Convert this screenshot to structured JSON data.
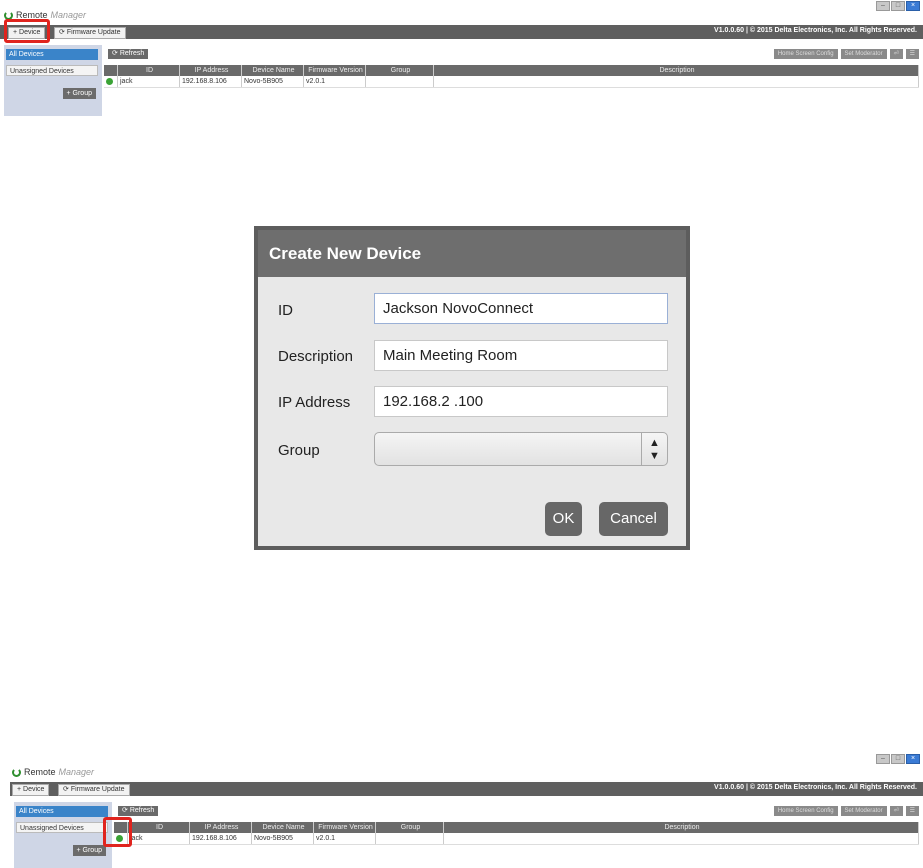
{
  "app": {
    "title_part1": "Remote",
    "title_part2": "Manager"
  },
  "window_controls": [
    "–",
    "□",
    "×"
  ],
  "toolbar": {
    "device_label": "+ Device",
    "firmware_label": "Firmware Update",
    "version": "V1.0.0.60  |  © 2015 Delta Electronics, Inc. All Rights Reserved."
  },
  "sidebar": {
    "items": [
      {
        "label": "All Devices"
      },
      {
        "label": "Unassigned Devices"
      }
    ],
    "add_group_label": "+ Group"
  },
  "main": {
    "refresh_label": "Refresh",
    "buttons": [
      "Home Screen Config",
      "Set Moderator",
      "⏎",
      "☰"
    ]
  },
  "table": {
    "columns": [
      "",
      "ID",
      "IP Address",
      "Device Name",
      "Firmware Version",
      "Group",
      "Description"
    ],
    "rows": [
      {
        "id": "jack",
        "ip": "192.168.8.106",
        "device_name": "Novo-5B905",
        "firmware": "v2.0.1",
        "group": "",
        "description": ""
      }
    ]
  },
  "dialog": {
    "title": "Create New Device",
    "id_label": "ID",
    "id_value": "Jackson NovoConnect",
    "description_label": "Description",
    "description_value": "Main Meeting Room",
    "ip_label": "IP Address",
    "ip_value": "192.168.2  .100",
    "group_label": "Group",
    "group_value": "",
    "ok_label": "OK",
    "cancel_label": "Cancel"
  },
  "colors": {
    "highlight": "#e0241e",
    "toolbar": "#5f5f5f",
    "online": "#3aa335",
    "dialog_header": "#6e6e6e"
  }
}
